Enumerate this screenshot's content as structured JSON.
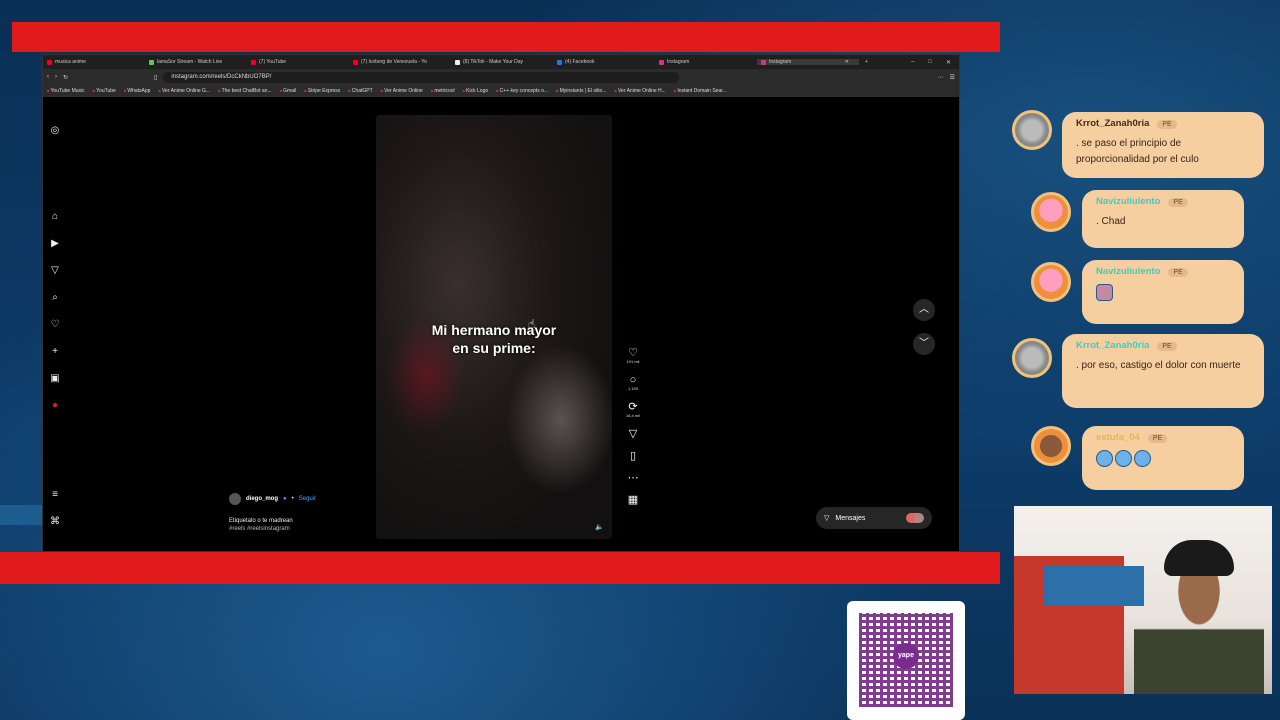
{
  "browser": {
    "tabs": [
      {
        "label": "musica anime",
        "active": false
      },
      {
        "label": "lamaSor Stream - Watch Live",
        "active": false
      },
      {
        "label": "(7) YouTube",
        "active": false
      },
      {
        "label": "(7) Iceberg de Venezuela - Yo",
        "active": false
      },
      {
        "label": "(8) TikTok - Make Your Day",
        "active": false
      },
      {
        "label": "(4) Facebook",
        "active": false
      },
      {
        "label": "Instagram",
        "active": false
      },
      {
        "label": "Instagram",
        "active": true
      }
    ],
    "url": "instagram.com/reels/DcCkNbUO7BP/",
    "bookmarks": [
      "YouTube Music",
      "YouTube",
      "WhatsApp",
      "Ver Anime Online G...",
      "The best ChatBot an...",
      "Gmail",
      "Stripe Express",
      "ChatGPT",
      "Ver Anime Online",
      "metricool",
      "Kick Logo",
      "C++ key concepts o...",
      "Myinstants | El sitio...",
      "Ver Anime Online H...",
      "Instant Domain Sear..."
    ]
  },
  "reel": {
    "caption": "Mi hermano mayor en su prime:",
    "caption_line1": "Mi hermano mayor",
    "caption_line2": "en su prime:",
    "likes": "191 mil",
    "comments": "1.159",
    "reposts": "16,4 mil",
    "author": "diego_mog",
    "follow_label": "Seguir",
    "description": "Etiquetalo o te madrean",
    "tags": "#reels #reelsinstagram"
  },
  "messages_label": "Mensajes",
  "chat": [
    {
      "user": "Krrot_Zanah0ria",
      "badge": "PE",
      "message": ". se paso el principio de proporcionalidad por el culo"
    },
    {
      "user": "Navizuliulento",
      "badge": "PE",
      "message": ". Chad"
    },
    {
      "user": "Navizuliulento",
      "badge": "PE",
      "message": ""
    },
    {
      "user": "Krrot_Zanah0ria",
      "badge": "PE",
      "message": ". por eso, castigo el dolor con muerte"
    },
    {
      "user": "estufa_04",
      "badge": "PE",
      "message": ""
    }
  ],
  "qr": {
    "brand": "yape"
  },
  "colors": {
    "red_band": "#e0191a",
    "chat_bubble": "#f5cfa0",
    "background": "#0b3a64"
  }
}
